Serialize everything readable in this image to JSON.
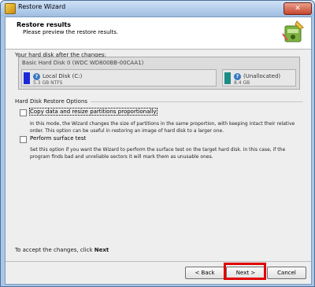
{
  "window": {
    "title": "Restore Wizard",
    "close_glyph": "✕"
  },
  "header": {
    "title": "Restore results",
    "subtitle": "Please preview the restore results."
  },
  "disk_section": {
    "label": "Your hard disk after the changes:",
    "disk_name": "Basic Hard Disk 0 (WDC WD800BB-00CAA1)",
    "partitions": [
      {
        "name": "Local Disk (C:)",
        "size": "5.3 GB NTFS",
        "color": "#1b2ad8"
      },
      {
        "name": "(Unallocated)",
        "size": "8.4 GB",
        "color": "#1d8c86"
      }
    ]
  },
  "options": {
    "label": "Hard Disk Restore Options",
    "items": [
      {
        "label": "Copy data and resize partitions proportionally",
        "checked": false,
        "description": "In this mode, the Wizard changes the size of partitions in the same proportion, with keeping intact their relative order. This option can be useful in restoring an image of hard disk to a larger one."
      },
      {
        "label": "Perform surface test",
        "checked": false,
        "description": "Set this option if you want the Wizard to perform the surface test on the target hard disk. In this case, if the program finds bad and unreliable sectors it will mark them as unusable ones."
      }
    ]
  },
  "footer": {
    "hint_prefix": "To accept the changes, click",
    "hint_target": "Next",
    "back_label": "< Back",
    "next_label": "Next >",
    "cancel_label": "Cancel"
  },
  "colors": {
    "highlight": "#e00000",
    "accent": "#3978c0"
  }
}
